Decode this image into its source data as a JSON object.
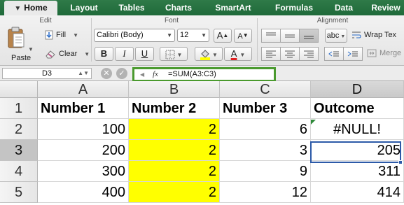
{
  "ribbon_tabs": [
    "Home",
    "Layout",
    "Tables",
    "Charts",
    "SmartArt",
    "Formulas",
    "Data",
    "Review"
  ],
  "ribbon": {
    "edit": {
      "title": "Edit",
      "paste_label": "Paste",
      "fill_label": "Fill",
      "clear_label": "Clear"
    },
    "font": {
      "title": "Font",
      "font_name": "Calibri (Body)",
      "font_size": "12",
      "grow_label": "A",
      "shrink_label": "A",
      "bold_label": "B",
      "italic_label": "I",
      "underline_label": "U",
      "font_color_label": "A",
      "fill_color": "#ffff00",
      "font_color": "#e02020"
    },
    "alignment": {
      "title": "Alignment",
      "orientation_label": "abc",
      "wrap_label": "Wrap Tex",
      "merge_label": "Merge"
    }
  },
  "formula_bar": {
    "name_box": "D3",
    "formula": "=SUM(A3:C3)",
    "fx_label": "fx"
  },
  "sheet": {
    "columns": [
      "A",
      "B",
      "C",
      "D"
    ],
    "rows": [
      "1",
      "2",
      "3",
      "4",
      "5"
    ],
    "active_cell": "D3",
    "cells": [
      [
        "Number 1",
        "Number 2",
        "Number 3",
        "Outcome"
      ],
      [
        "100",
        "2",
        "6",
        "#NULL!"
      ],
      [
        "200",
        "2",
        "3",
        "205"
      ],
      [
        "300",
        "2",
        "9",
        "311"
      ],
      [
        "400",
        "2",
        "12",
        "414"
      ]
    ],
    "highlight_color": "#ffff00",
    "selection_color": "#2c5aa8"
  }
}
